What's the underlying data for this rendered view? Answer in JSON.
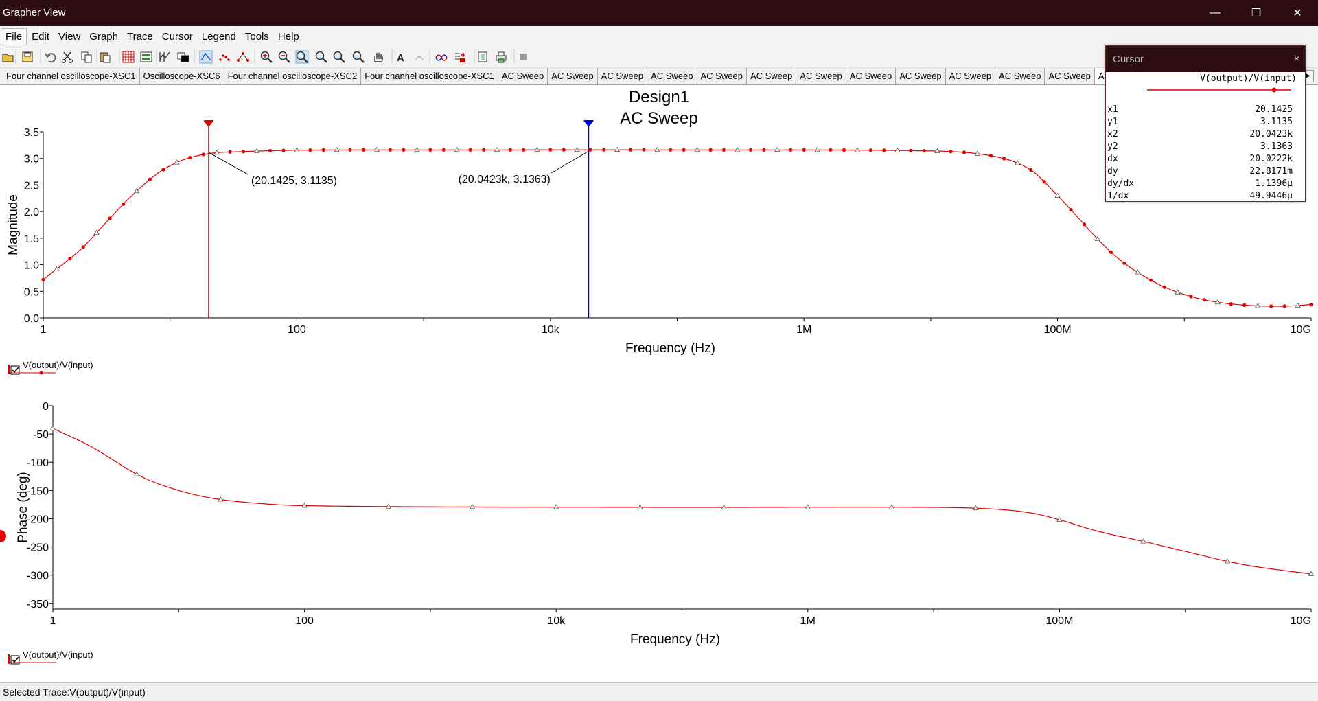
{
  "window": {
    "title": "Grapher View"
  },
  "menu": [
    "File",
    "Edit",
    "View",
    "Graph",
    "Trace",
    "Cursor",
    "Legend",
    "Tools",
    "Help"
  ],
  "toolbar_icons": [
    "open-icon",
    "save-icon",
    "undo-icon",
    "cut-icon",
    "copy-icon",
    "paste-icon",
    "grid-icon",
    "legend-icon",
    "show-cursors-icon",
    "overlay-icon",
    "line-trace-icon",
    "dots-trace-icon",
    "line-dots-trace-icon",
    "zoom-in-icon",
    "zoom-out-icon",
    "zoom-area-icon",
    "zoom-x-icon",
    "zoom-y-icon",
    "zoom-full-icon",
    "pan-hand-icon",
    "text-icon",
    "properties-icon",
    "trace-props-icon",
    "export-icon",
    "print-preview-icon",
    "print-icon",
    "stop-icon"
  ],
  "tabs": [
    "Four channel oscilloscope-XSC1",
    "Oscilloscope-XSC6",
    "Four channel oscilloscope-XSC2",
    "Four channel oscilloscope-XSC1",
    "AC Sweep",
    "AC Sweep",
    "AC Sweep",
    "AC Sweep",
    "AC Sweep",
    "AC Sweep",
    "AC Sweep",
    "AC Sweep",
    "AC Sweep",
    "AC Sweep",
    "AC Sweep",
    "AC Sweep",
    "AC Sweep"
  ],
  "active_tab": 16,
  "colors": {
    "trace": "#e00000",
    "cursor1": "#e00000",
    "cursor2": "#0000e0",
    "titlebar": "#2b0c10"
  },
  "graph": {
    "title_line1": "Design1",
    "title_line2": "AC Sweep",
    "cursor1_label": "(20.1425, 3.1135)",
    "cursor2_label": "(20.0423k, 3.1363)",
    "legend_top": "V(output)/V(input)",
    "legend_bottom": "V(output)/V(input)"
  },
  "chart_data": [
    {
      "type": "line",
      "xlabel": "Frequency (Hz)",
      "ylabel": "Magnitude",
      "xscale": "log",
      "xlim": [
        1,
        10000000000
      ],
      "ylim": [
        0,
        3.5
      ],
      "x_tick_labels": [
        "1",
        "100",
        "10k",
        "1M",
        "100M",
        "10G"
      ],
      "y_tick_labels": [
        "3.5",
        "3.0",
        "2.5",
        "2.0",
        "1.5",
        "1.0",
        "0.5",
        "0.0"
      ],
      "series": [
        {
          "name": "V(output)/V(input)",
          "x": [
            1,
            2,
            3,
            5,
            8,
            12,
            20,
            40,
            80,
            200,
            1000,
            100000,
            10000000,
            30000000,
            60000000,
            100000000,
            150000000,
            200000000,
            300000000,
            500000000,
            800000000,
            1500000000,
            3000000000,
            6000000000,
            10000000000
          ],
          "y": [
            0.72,
            1.3,
            1.75,
            2.3,
            2.72,
            2.95,
            3.09,
            3.13,
            3.15,
            3.16,
            3.16,
            3.16,
            3.14,
            3.05,
            2.8,
            2.3,
            1.85,
            1.52,
            1.12,
            0.76,
            0.52,
            0.33,
            0.24,
            0.22,
            0.25
          ]
        }
      ],
      "cursors": [
        {
          "name": "1",
          "x": 20.1425,
          "y": 3.1135
        },
        {
          "name": "2",
          "x": 20042.3,
          "y": 3.1363
        }
      ]
    },
    {
      "type": "line",
      "xlabel": "Frequency (Hz)",
      "ylabel": "Phase (deg)",
      "xscale": "log",
      "xlim": [
        1,
        10000000000
      ],
      "ylim": [
        -360,
        0
      ],
      "x_tick_labels": [
        "1",
        "100",
        "10k",
        "1M",
        "100M",
        "10G"
      ],
      "y_tick_labels": [
        "0",
        "-50",
        "-100",
        "-150",
        "-200",
        "-250",
        "-300",
        "-350"
      ],
      "series": [
        {
          "name": "V(output)/V(input)",
          "x": [
            1,
            2,
            5,
            10,
            20,
            50,
            100,
            1000,
            100000,
            10000000,
            30000000,
            60000000,
            100000000,
            200000000,
            500000000,
            1000000000,
            3000000000,
            10000000000
          ],
          "y": [
            -40,
            -72,
            -125,
            -150,
            -165,
            -174,
            -177,
            -179,
            -180,
            -180,
            -183,
            -190,
            -202,
            -222,
            -242,
            -258,
            -282,
            -298
          ]
        }
      ]
    }
  ],
  "cursor_panel": {
    "title": "Cursor",
    "close": "×",
    "trace": "V(output)/V(input)",
    "rows": [
      {
        "label": "x1",
        "value": "20.1425"
      },
      {
        "label": "y1",
        "value": "3.1135"
      },
      {
        "label": "x2",
        "value": "20.0423k"
      },
      {
        "label": "y2",
        "value": "3.1363"
      },
      {
        "label": "dx",
        "value": "20.0222k"
      },
      {
        "label": "dy",
        "value": "22.8171m"
      },
      {
        "label": "dy/dx",
        "value": "1.1396μ"
      },
      {
        "label": "1/dx",
        "value": "49.9446μ"
      }
    ]
  },
  "status": {
    "text": "Selected Trace:V(output)/V(input)"
  }
}
